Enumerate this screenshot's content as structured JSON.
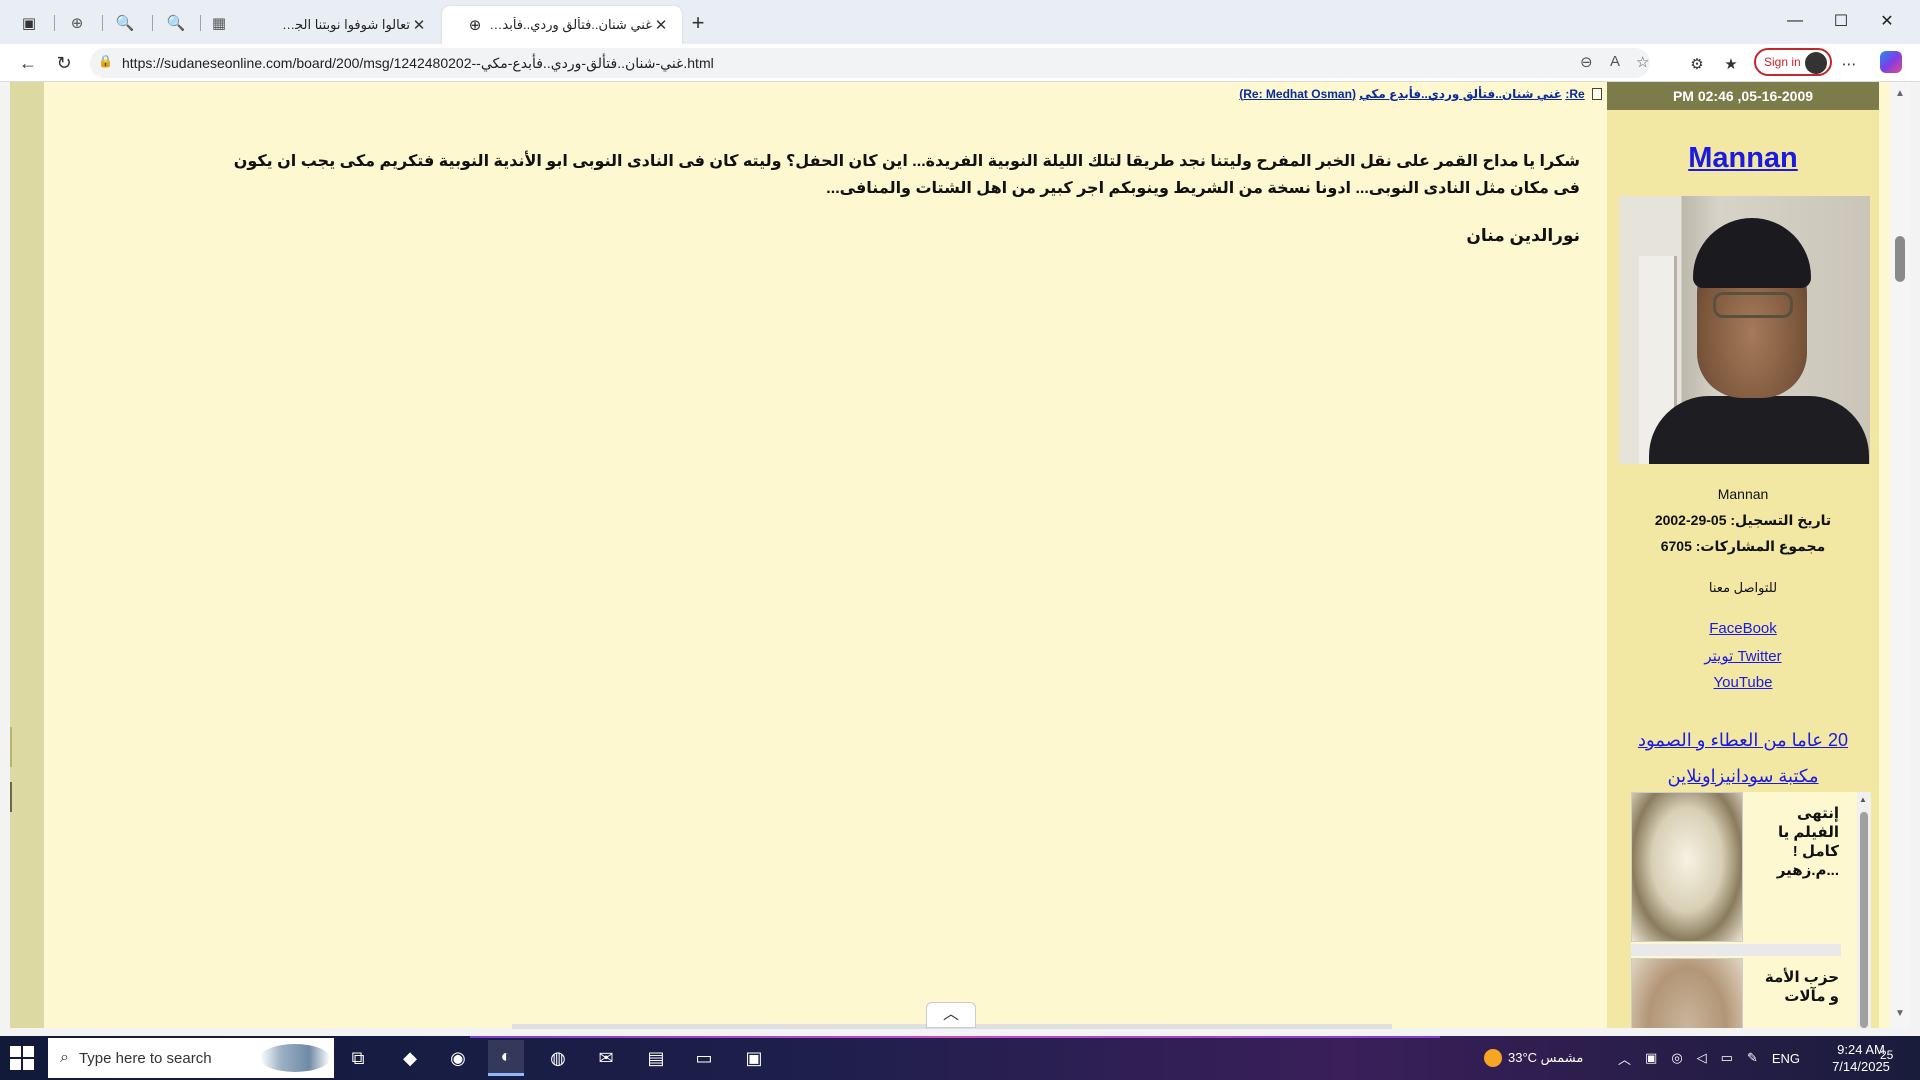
{
  "browser": {
    "tabs": [
      {
        "title": "تعالوا شوفوا نوبتنا الجميلة",
        "active": false
      },
      {
        "title": "غني شنان..فتألق وردي..فأبدع مكي",
        "active": true
      }
    ],
    "url": "https://sudaneseonline.com/board/200/msg/1242480202--غني-شنان..فتألق-وردي..فأبدع-مكي.html",
    "sign_in_label": "Sign in"
  },
  "post": {
    "link_prefix": "Re:",
    "link_title": "غني شنان..فتألق وردي..فأبدع مكي",
    "link_reply": "(Re: Medhat Osman)",
    "body": "شكرا يا مداح القمر على نقل الخبر المفرح وليتنا نجد طريقا لتلك الليلة النوبية الفريدة... اين كان الحفل؟ وليته كان فى النادى النوبى ابو الأندية النوبية فتكريم مكى يجب ان يكون فى مكان مثل النادى النوبى... ادونا نسخة من الشريط وينوبكم اجر كبير من اهل الشتات والمنافى...",
    "signature": "نورالدين منان"
  },
  "sidebar": {
    "date": "05-16-2009, 02:46 PM",
    "username": "Mannan",
    "username_plain": "Mannan",
    "registration": "تاريخ التسجيل: 05-29-2002",
    "posts_count": "مجموع المشاركات: 6705",
    "contact_label": "للتواصل معنا",
    "links": [
      "FaceBook",
      "تويتر Twitter",
      "YouTube"
    ],
    "promo_1": "20 عاما من العطاء و الصمود",
    "promo_2": "مكتبة سودانيزاونلاين",
    "ticker": [
      {
        "text": "إنتهى الفيلم يا كامل ! ...م.زهير"
      },
      {
        "text": "حزب الأمة و مآلات"
      }
    ]
  },
  "taskbar": {
    "search_placeholder": "Type here to search",
    "weather": "33°C مشمس",
    "language": "ENG",
    "time": "9:24 AM",
    "date": "7/14/2025",
    "notifications": "25"
  },
  "colors": {
    "page_bg": "#fdf8cf",
    "sidebar_bg": "#f2e7a3",
    "date_bar": "#7c7b4a",
    "link": "#1a1ae0"
  }
}
